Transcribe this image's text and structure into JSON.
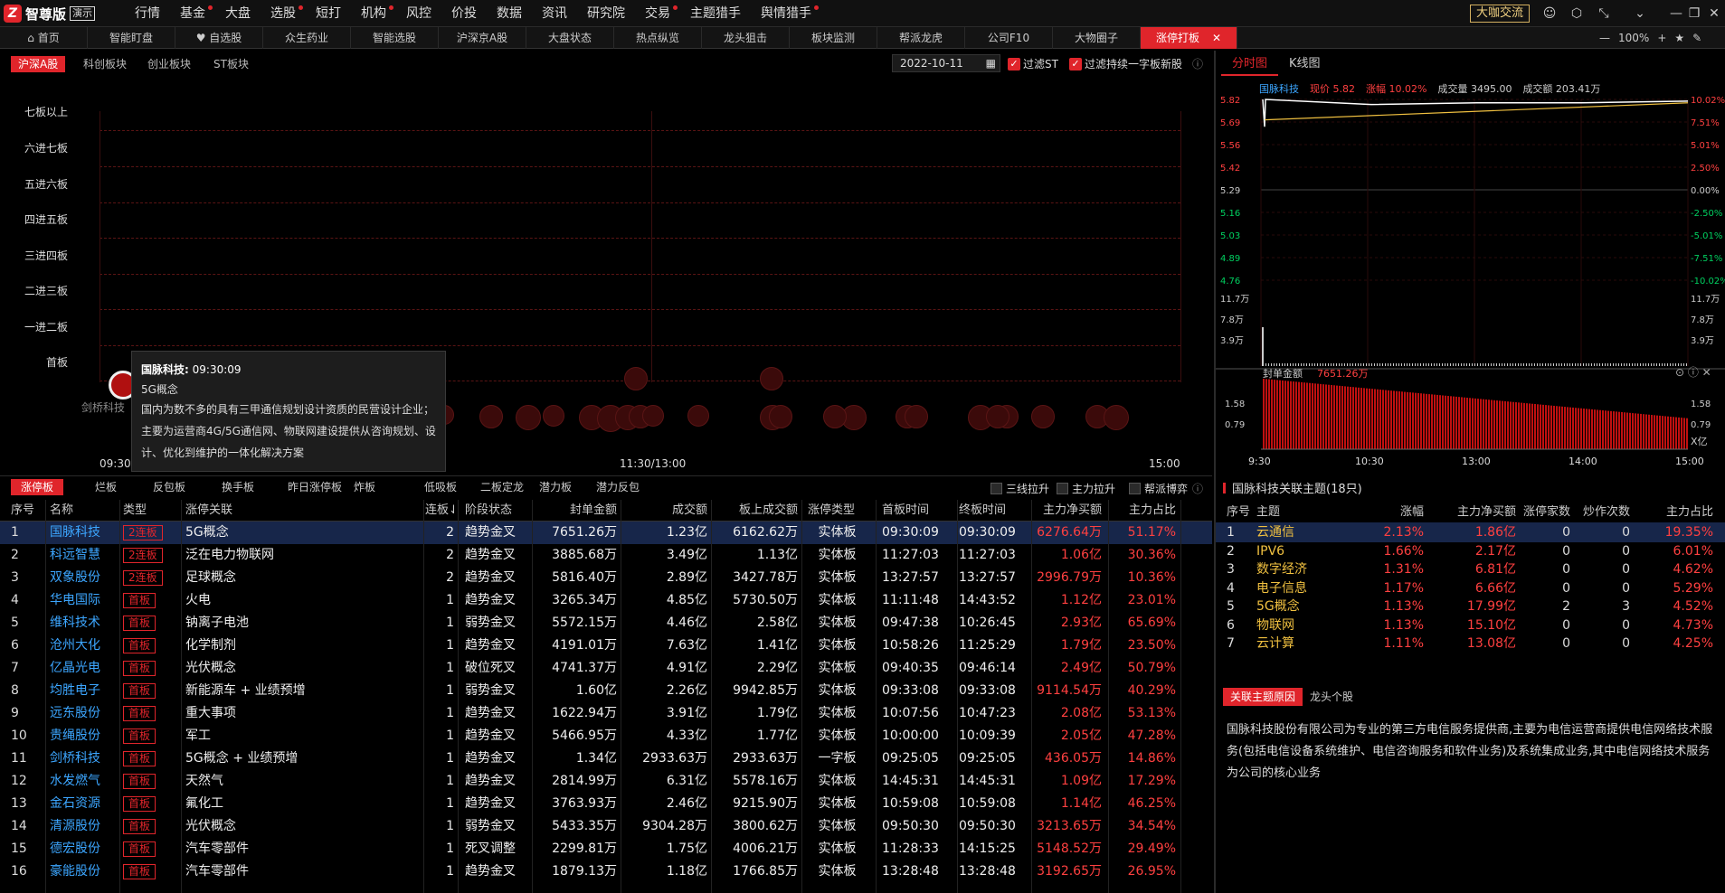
{
  "app": {
    "logo_text": "智尊版",
    "badge": "演示",
    "coffee": "大咖交流"
  },
  "menu": [
    {
      "label": "行情",
      "dot": false
    },
    {
      "label": "基金",
      "dot": true
    },
    {
      "label": "大盘",
      "dot": false
    },
    {
      "label": "选股",
      "dot": true
    },
    {
      "label": "短打",
      "dot": false
    },
    {
      "label": "机构",
      "dot": true
    },
    {
      "label": "风控",
      "dot": false
    },
    {
      "label": "价投",
      "dot": false
    },
    {
      "label": "数据",
      "dot": false
    },
    {
      "label": "资讯",
      "dot": false
    },
    {
      "label": "研究院",
      "dot": false
    },
    {
      "label": "交易",
      "dot": true
    },
    {
      "label": "主题猎手",
      "dot": false
    },
    {
      "label": "舆情猎手",
      "dot": true
    }
  ],
  "tabs": [
    "首页",
    "智能盯盘",
    "自选股",
    "众生药业",
    "智能选股",
    "沪深京A股",
    "大盘状态",
    "热点纵览",
    "龙头狙击",
    "板块监测",
    "帮派龙虎",
    "公司F10",
    "大物圈子",
    "涨停打板"
  ],
  "zoom": "100%",
  "market_tabs": [
    "沪深A股",
    "科创板块",
    "创业板块",
    "ST板块"
  ],
  "date": "2022-10-11",
  "filters": {
    "st": "过滤ST",
    "one_word": "过滤持续一字板新股"
  },
  "levels": [
    "七板以上",
    "六进七板",
    "五进六板",
    "四进五板",
    "三进四板",
    "二进三板",
    "一进二板",
    "首板"
  ],
  "time_axis": [
    "09:30",
    "11:30/13:00",
    "15:00"
  ],
  "bubble_labels": [
    "剑桥科技"
  ],
  "tooltip": {
    "name": "国脉科技:",
    "time": "09:30:09",
    "concept": "5G概念",
    "desc": "国内为数不多的具有三甲通信规划设计资质的民营设计企业；主要为运营商4G/5G通信网、物联网建设提供从咨询规划、设计、优化到维护的一体化解决方案"
  },
  "bottom_tabs": [
    "涨停板",
    "烂板",
    "反包板",
    "换手板",
    "昨日涨停板",
    "炸板",
    "低吸板",
    "二板定龙",
    "潜力板",
    "潜力反包"
  ],
  "bottom_checks": [
    "三线拉升",
    "主力拉升",
    "帮派博弈"
  ],
  "table": {
    "headers": [
      "序号",
      "名称",
      "类型",
      "涨停关联",
      "连板↓",
      "阶段状态",
      "封单金额",
      "成交额",
      "板上成交额",
      "涨停类型",
      "首板时间",
      "终板时间",
      "主力净买额",
      "主力占比"
    ],
    "rows": [
      [
        "1",
        "国脉科技",
        "2连板",
        "5G概念",
        "2",
        "趋势金叉",
        "7651.26万",
        "1.23亿",
        "6162.62万",
        "实体板",
        "09:30:09",
        "09:30:09",
        "6276.64万",
        "51.17%"
      ],
      [
        "2",
        "科远智慧",
        "2连板",
        "泛在电力物联网",
        "2",
        "趋势金叉",
        "3885.68万",
        "3.49亿",
        "1.13亿",
        "实体板",
        "11:27:03",
        "11:27:03",
        "1.06亿",
        "30.36%"
      ],
      [
        "3",
        "双象股份",
        "2连板",
        "足球概念",
        "2",
        "趋势金叉",
        "5816.40万",
        "2.89亿",
        "3427.78万",
        "实体板",
        "13:27:57",
        "13:27:57",
        "2996.79万",
        "10.36%"
      ],
      [
        "4",
        "华电国际",
        "首板",
        "火电",
        "1",
        "趋势金叉",
        "3265.34万",
        "4.85亿",
        "5730.50万",
        "实体板",
        "11:11:48",
        "14:43:52",
        "1.12亿",
        "23.01%"
      ],
      [
        "5",
        "维科技术",
        "首板",
        "钠离子电池",
        "1",
        "弱势金叉",
        "5572.15万",
        "4.46亿",
        "2.58亿",
        "实体板",
        "09:47:38",
        "10:26:45",
        "2.93亿",
        "65.69%"
      ],
      [
        "6",
        "沧州大化",
        "首板",
        "化学制剂",
        "1",
        "趋势金叉",
        "4191.01万",
        "7.63亿",
        "1.41亿",
        "实体板",
        "10:58:26",
        "11:25:29",
        "1.79亿",
        "23.50%"
      ],
      [
        "7",
        "亿晶光电",
        "首板",
        "光伏概念",
        "1",
        "破位死叉",
        "4741.37万",
        "4.91亿",
        "2.29亿",
        "实体板",
        "09:40:35",
        "09:46:14",
        "2.49亿",
        "50.79%"
      ],
      [
        "8",
        "均胜电子",
        "首板",
        "新能源车 + 业绩预增",
        "1",
        "弱势金叉",
        "1.60亿",
        "2.26亿",
        "9942.85万",
        "实体板",
        "09:33:08",
        "09:33:08",
        "9114.54万",
        "40.29%"
      ],
      [
        "9",
        "远东股份",
        "首板",
        "重大事项",
        "1",
        "趋势金叉",
        "1622.94万",
        "3.91亿",
        "1.79亿",
        "实体板",
        "10:07:56",
        "10:47:23",
        "2.08亿",
        "53.13%"
      ],
      [
        "10",
        "贵绳股份",
        "首板",
        "军工",
        "1",
        "趋势金叉",
        "5466.95万",
        "4.33亿",
        "1.77亿",
        "实体板",
        "10:00:00",
        "10:09:39",
        "2.05亿",
        "47.28%"
      ],
      [
        "11",
        "剑桥科技",
        "首板",
        "5G概念 + 业绩预增",
        "1",
        "趋势金叉",
        "1.34亿",
        "2933.63万",
        "2933.63万",
        "一字板",
        "09:25:05",
        "09:25:05",
        "436.05万",
        "14.86%"
      ],
      [
        "12",
        "水发燃气",
        "首板",
        "天然气",
        "1",
        "趋势金叉",
        "2814.99万",
        "6.31亿",
        "5578.16万",
        "实体板",
        "14:45:31",
        "14:45:31",
        "1.09亿",
        "17.29%"
      ],
      [
        "13",
        "金石资源",
        "首板",
        "氟化工",
        "1",
        "趋势金叉",
        "3763.93万",
        "2.46亿",
        "9215.90万",
        "实体板",
        "10:59:08",
        "10:59:08",
        "1.14亿",
        "46.25%"
      ],
      [
        "14",
        "清源股份",
        "首板",
        "光伏概念",
        "1",
        "弱势金叉",
        "5433.35万",
        "9304.28万",
        "3800.62万",
        "实体板",
        "09:50:30",
        "09:50:30",
        "3213.65万",
        "34.54%"
      ],
      [
        "15",
        "德宏股份",
        "首板",
        "汽车零部件",
        "1",
        "死叉调整",
        "2299.81万",
        "1.75亿",
        "4006.21万",
        "实体板",
        "11:28:33",
        "14:15:25",
        "5148.52万",
        "29.49%"
      ],
      [
        "16",
        "豪能股份",
        "首板",
        "汽车零部件",
        "1",
        "趋势金叉",
        "1879.13万",
        "1.18亿",
        "1766.85万",
        "实体板",
        "13:28:48",
        "13:28:48",
        "3192.65万",
        "26.95%"
      ]
    ]
  },
  "right": {
    "tabs": [
      "分时图",
      "K线图"
    ],
    "quote": {
      "name": "国脉科技",
      "price": "现价 5.82",
      "change": "涨幅 10.02%",
      "volume": "成交量 3495.00",
      "amount": "成交额 203.41万"
    },
    "price_labels": [
      "5.82",
      "5.69",
      "5.56",
      "5.42",
      "5.29",
      "5.16",
      "5.03",
      "4.89",
      "4.76"
    ],
    "pct_labels": [
      "10.02%",
      "7.51%",
      "5.01%",
      "2.50%",
      "0.00%",
      "-2.50%",
      "-5.01%",
      "-7.51%",
      "-10.02%"
    ],
    "vol_labels": [
      "11.7万",
      "7.8万",
      "3.9万"
    ],
    "seal_title": "封单金额",
    "seal_value": "7651.26万",
    "seal_labels": [
      "1.58",
      "0.79"
    ],
    "seal_unit": "X亿",
    "time_labels": [
      "9:30",
      "10:30",
      "13:00",
      "14:00",
      "15:00"
    ]
  },
  "chart_data": {
    "type": "line",
    "x": [
      "9:30",
      "10:30",
      "13:00",
      "14:00",
      "15:00"
    ],
    "series": [
      {
        "values": [
          5.82,
          5.79,
          5.8,
          5.8,
          5.81
        ]
      }
    ],
    "ylim": [
      4.76,
      5.82
    ]
  },
  "related": {
    "title": "国脉科技关联主题(18只)",
    "headers": [
      "序号",
      "主题",
      "涨幅",
      "主力净买额",
      "涨停家数",
      "炒作次数",
      "主力占比"
    ],
    "rows": [
      [
        "1",
        "云通信",
        "2.13%",
        "1.86亿",
        "0",
        "0",
        "19.35%"
      ],
      [
        "2",
        "IPV6",
        "1.66%",
        "2.17亿",
        "0",
        "0",
        "6.01%"
      ],
      [
        "3",
        "数字经济",
        "1.31%",
        "6.81亿",
        "0",
        "0",
        "4.62%"
      ],
      [
        "4",
        "电子信息",
        "1.17%",
        "6.66亿",
        "0",
        "0",
        "5.29%"
      ],
      [
        "5",
        "5G概念",
        "1.13%",
        "17.99亿",
        "2",
        "3",
        "4.52%"
      ],
      [
        "6",
        "物联网",
        "1.13%",
        "15.10亿",
        "0",
        "0",
        "4.73%"
      ],
      [
        "7",
        "云计算",
        "1.11%",
        "13.08亿",
        "0",
        "0",
        "4.25%"
      ]
    ],
    "reason_tabs": [
      "关联主题原因",
      "龙头个股"
    ],
    "reason": "国脉科技股份有限公司为专业的第三方电信服务提供商,主要为电信运营商提供电信网络技术服务(包括电信设备系统维护、电信咨询服务和软件业务)及系统集成业务,其中电信网络技术服务为公司的核心业务"
  },
  "colors": {
    "accent": "#e0252b",
    "up": "#ff4040",
    "down": "#00d060",
    "link": "#3ca6ff",
    "selected": "#17264a"
  }
}
